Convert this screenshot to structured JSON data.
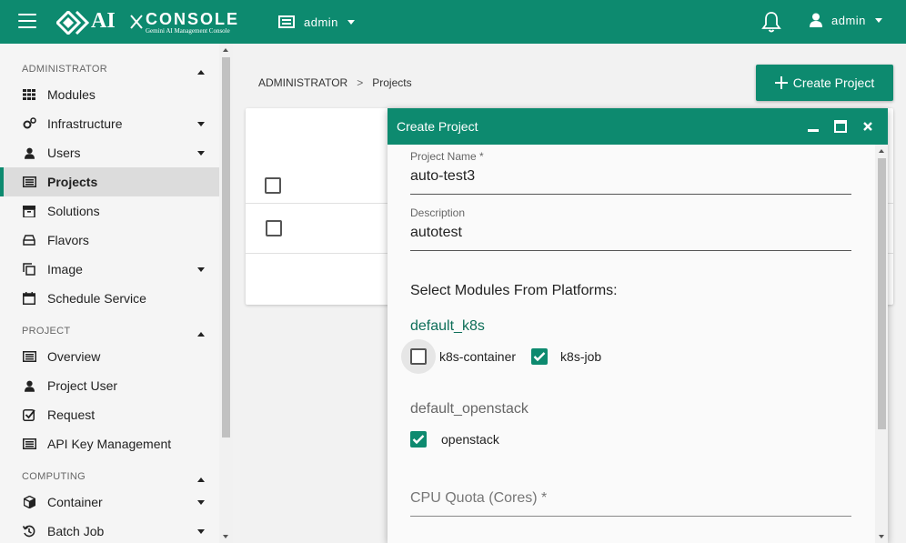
{
  "colors": {
    "brand": "#0d8a6f",
    "sidebar_bg": "#f5f5f5",
    "active_item_bg": "#dcdcdc"
  },
  "header": {
    "logo_main": "AI",
    "logo_console": "CONSOLE",
    "logo_sub": "Gemini AI Management Console",
    "env_label": "admin",
    "user_label": "admin",
    "icons": [
      "menu-icon",
      "project-icon",
      "bell-icon",
      "user-icon"
    ]
  },
  "sidebar": {
    "sections": [
      {
        "label": "ADMINISTRATOR",
        "items": [
          {
            "label": "Modules",
            "icon": "grid-icon",
            "expandable": false
          },
          {
            "label": "Infrastructure",
            "icon": "cogs-icon",
            "expandable": true
          },
          {
            "label": "Users",
            "icon": "user-icon",
            "expandable": true
          },
          {
            "label": "Projects",
            "icon": "list-icon",
            "expandable": false,
            "active": true
          },
          {
            "label": "Solutions",
            "icon": "box-icon",
            "expandable": false
          },
          {
            "label": "Flavors",
            "icon": "drive-icon",
            "expandable": false
          },
          {
            "label": "Image",
            "icon": "copy-icon",
            "expandable": true
          },
          {
            "label": "Schedule Service",
            "icon": "calendar-icon",
            "expandable": false
          }
        ]
      },
      {
        "label": "PROJECT",
        "items": [
          {
            "label": "Overview",
            "icon": "list-icon",
            "expandable": false
          },
          {
            "label": "Project User",
            "icon": "user-icon",
            "expandable": false
          },
          {
            "label": "Request",
            "icon": "check-square-icon",
            "expandable": false
          },
          {
            "label": "API Key Management",
            "icon": "list-icon",
            "expandable": false
          }
        ]
      },
      {
        "label": "COMPUTING",
        "items": [
          {
            "label": "Container",
            "icon": "cube-icon",
            "expandable": true
          },
          {
            "label": "Batch Job",
            "icon": "history-icon",
            "expandable": true
          }
        ]
      }
    ]
  },
  "breadcrumb": {
    "root": "ADMINISTRATOR",
    "separator": ">",
    "current": "Projects"
  },
  "create_button": {
    "label": "Create Project"
  },
  "dialog": {
    "title": "Create Project",
    "project_name": {
      "label": "Project Name",
      "required_mark": "*",
      "value": "auto-test3"
    },
    "description": {
      "label": "Description",
      "value": "autotest"
    },
    "modules_title": "Select Modules From Platforms:",
    "platforms": [
      {
        "name": "default_k8s",
        "active": true,
        "modules": [
          {
            "label": "k8s-container",
            "checked": false
          },
          {
            "label": "k8s-job",
            "checked": true
          }
        ]
      },
      {
        "name": "default_openstack",
        "active": false,
        "modules": [
          {
            "label": "openstack",
            "checked": true
          }
        ]
      }
    ],
    "cpu_quota": {
      "label": "CPU Quota (Cores)",
      "required_mark": "*"
    }
  }
}
